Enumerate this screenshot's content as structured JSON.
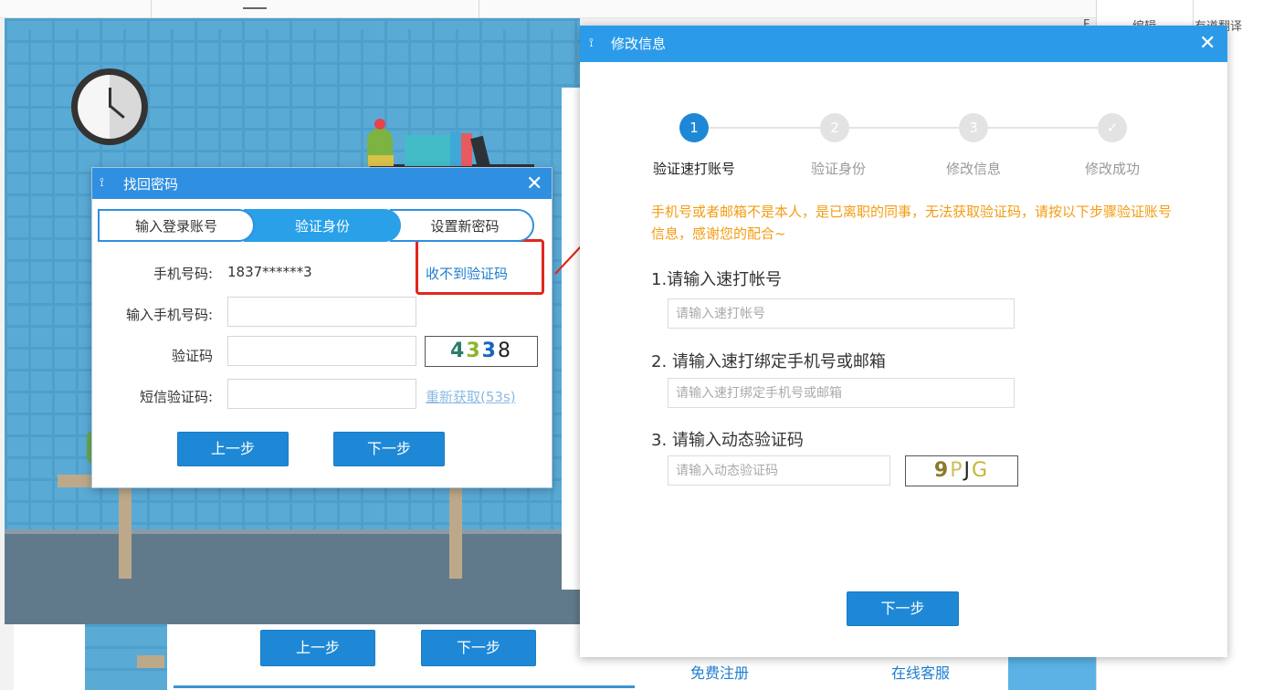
{
  "back": {
    "right_grid": {
      "edit_label": "编辑",
      "translate_label": "有道翻译",
      "col_char": "F"
    },
    "dialog": {
      "prev_label": "上一步",
      "next_label": "下一步",
      "free_register": "免费注册",
      "online_service": "在线客服"
    }
  },
  "dialog1": {
    "icon": "⟟",
    "title": "找回密码",
    "close": "✕",
    "steps": [
      "输入登录账号",
      "验证身份",
      "设置新密码"
    ],
    "active_step": 1,
    "phone_label": "手机号码:",
    "phone_value": "1837******3",
    "no_code_link": "收不到验证码",
    "input_phone_label": "输入手机号码:",
    "captcha_label": "验证码",
    "captcha_text": [
      "4",
      "3",
      "3",
      "8"
    ],
    "captcha_colors": [
      "#2e7d6c",
      "#8bb52c",
      "#1565c0",
      "#222222"
    ],
    "sms_label": "短信验证码:",
    "resend_link": "重新获取(53s)",
    "prev_button": "上一步",
    "next_button": "下一步",
    "colors": {
      "titlebar": "#2f8fe0",
      "button": "#1e88d6",
      "highlight_box": "#e3261d"
    }
  },
  "dialog2": {
    "icon": "⟟",
    "title": "修改信息",
    "close": "✕",
    "steps": [
      {
        "num": "1",
        "label": "验证速打账号",
        "active": true
      },
      {
        "num": "2",
        "label": "验证身份",
        "active": false
      },
      {
        "num": "3",
        "label": "修改信息",
        "active": false
      },
      {
        "num": "✓",
        "label": "修改成功",
        "active": false
      }
    ],
    "notice": "手机号或者邮箱不是本人，是已离职的同事，无法获取验证码，请按以下步骤验证账号信息，感谢您的配合~",
    "q1": "1.请输入速打帐号",
    "q1_placeholder": "请输入速打帐号",
    "q2": "2. 请输入速打绑定手机号或邮箱",
    "q2_placeholder": "请输入速打绑定手机号或邮箱",
    "q3": "3. 请输入动态验证码",
    "q3_placeholder": "请输入动态验证码",
    "captcha_text": [
      "9",
      "P",
      "J",
      "G"
    ],
    "captcha_colors": [
      "#8a7a2a",
      "#c8c060",
      "#222222",
      "#c0b838"
    ],
    "next_button": "下一步",
    "colors": {
      "titlebar": "#2b9be9",
      "active_step": "#1e88d6",
      "notice": "#f39c12"
    }
  }
}
